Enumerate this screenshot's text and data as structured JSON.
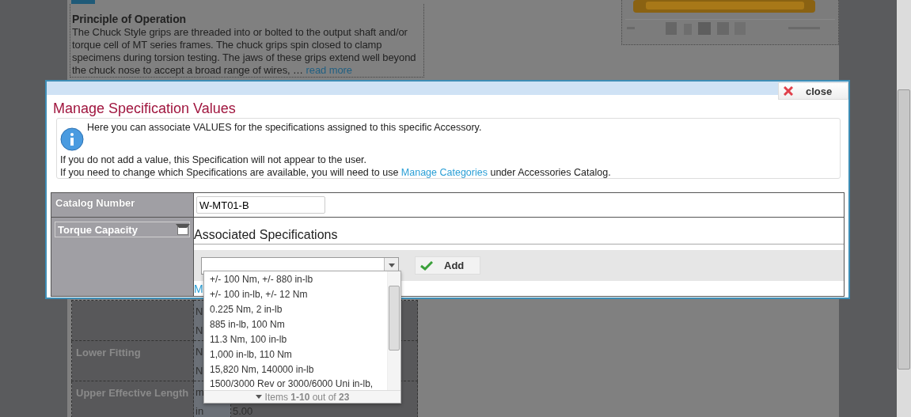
{
  "background_page": {
    "heading": "Principle of Operation",
    "paragraph": "The Chuck Style grips are threaded into or bolted to the output shaft and/or torque cell of MT series frames. The chuck grips spin closed to clamp specimens during torsion testing. The jaws of these grips extend well beyond the chuck nose to accept a broad range of wires, …",
    "read_more": "read more",
    "table_rows": [
      {
        "lines": [
          {
            "unit": "N"
          },
          {
            "unit": "N"
          }
        ]
      },
      {
        "label": "Lower Fitting",
        "lines": [
          {
            "unit": "N"
          },
          {
            "unit": "N"
          }
        ]
      },
      {
        "label": "Upper Effective Length",
        "lines": [
          {
            "unit": "m"
          },
          {
            "unit": "in",
            "value": "5.00"
          }
        ]
      }
    ]
  },
  "dialog": {
    "title": "Manage Specification Values",
    "close_label": "close",
    "info": {
      "lead": "Here you can associate VALUES for the specifications assigned to this specific Accessory.",
      "note": "If you do not add a value, this Specification will not appear to the user.",
      "hint_before": "If you need to change which Specifications are available, you will need to use",
      "hint_link": "Manage Categories",
      "hint_after": "under Accessories Catalog."
    },
    "catalog_number": {
      "label": "Catalog Number",
      "value": "W-MT01-B"
    },
    "spec_select": {
      "value": "Torque Capacity"
    },
    "section_title": "Associated Specifications",
    "add_button": "Add",
    "partial_link": "M",
    "dropdown": {
      "options": [
        "+/- 100 Nm, +/- 880 in-lb",
        "+/- 100 in-lb, +/- 12 Nm",
        "0.225 Nm, 2 in-lb",
        "885 in-lb, 100 Nm",
        "11.3 Nm, 100 in-lb",
        "1,000 in-lb, 110 Nm",
        "15,820 Nm, 140000 in-lb",
        "1500/3000 Rev or 3000/6000 Uni in-lb,"
      ],
      "footer": "Items **1-10** out of **23**"
    }
  }
}
